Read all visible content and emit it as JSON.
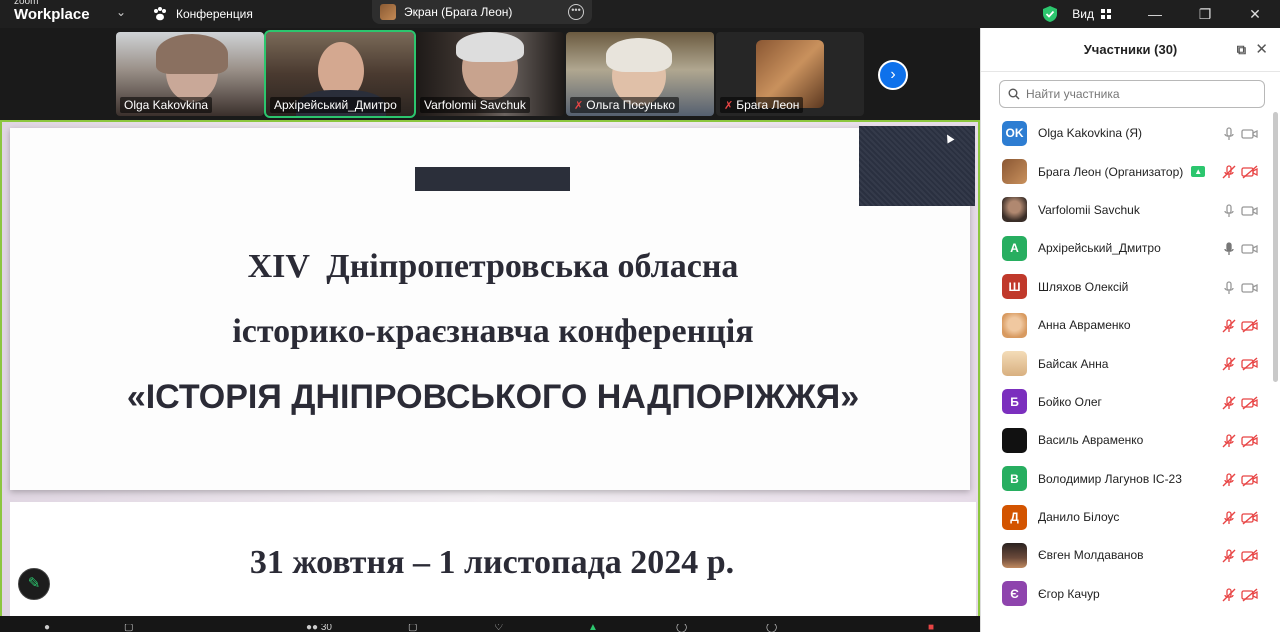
{
  "titlebar": {
    "brand_small": "zoom",
    "brand_main": "Workplace",
    "meeting_label": "Конференция",
    "share_label": "Экран (Брага Леон)",
    "view_label": "Вид"
  },
  "colors": {
    "accent_green": "#2cc66e",
    "accent_blue": "#0e71eb",
    "mute_red": "#e84545",
    "screen_border": "#8cc63f"
  },
  "video_tiles": [
    {
      "name": "Olga Kakovkina",
      "muted": false
    },
    {
      "name": "Архірейський_Дмитро",
      "muted": false,
      "active": true
    },
    {
      "name": "Varfolomii Savchuk",
      "muted": false
    },
    {
      "name": "Ольга Посунько",
      "muted": true
    },
    {
      "name": "Брага Леон",
      "muted": true
    }
  ],
  "slide": {
    "line1": "XIV  Дніпропетровська обласна",
    "line2": "історико-краєзнавча конференція",
    "line3": "«ІСТОРІЯ ДНІПРОВСЬКОГО НАДПОРІЖЖЯ»",
    "date": "31 жовтня – 1 листопада 2024 р."
  },
  "bottombar": {
    "participants_count": "30"
  },
  "panel": {
    "title": "Участники (30)",
    "search_placeholder": "Найти участника",
    "participants": [
      {
        "initials": "OK",
        "name": "Olga Kakovkina (Я)",
        "color": "#2d7dd2",
        "mic": "on",
        "cam": "on"
      },
      {
        "initials": "",
        "name": "Брага Леон (Организатор)",
        "color": "#a0673a",
        "mic": "off",
        "cam": "off",
        "sharing": true
      },
      {
        "initials": "",
        "name": "Varfolomii Savchuk",
        "color": "#5a4a3f",
        "mic": "on",
        "cam": "on"
      },
      {
        "initials": "А",
        "name": "Архірейський_Дмитро",
        "color": "#27ae60",
        "mic": "active",
        "cam": "on"
      },
      {
        "initials": "Ш",
        "name": "Шляхов Олексій",
        "color": "#c0392b",
        "mic": "on",
        "cam": "on"
      },
      {
        "initials": "",
        "name": "Анна Авраменко",
        "color": "#e0a070",
        "mic": "off",
        "cam": "off"
      },
      {
        "initials": "",
        "name": "Байсак Анна",
        "color": "#e8c9a0",
        "mic": "off",
        "cam": "off"
      },
      {
        "initials": "Б",
        "name": "Бойко Олег",
        "color": "#7b2fbe",
        "mic": "off",
        "cam": "off"
      },
      {
        "initials": "",
        "name": "Василь Авраменко",
        "color": "#111111",
        "mic": "off",
        "cam": "off"
      },
      {
        "initials": "В",
        "name": "Володимир Лагунов ІС-23",
        "color": "#27ae60",
        "mic": "off",
        "cam": "off"
      },
      {
        "initials": "Д",
        "name": "Данило Білоус",
        "color": "#d35400",
        "mic": "off",
        "cam": "off"
      },
      {
        "initials": "",
        "name": "Євген Молдаванов",
        "color": "#6b4a3a",
        "mic": "off",
        "cam": "off"
      },
      {
        "initials": "Є",
        "name": "Єгор Качур",
        "color": "#8e44ad",
        "mic": "off",
        "cam": "off"
      }
    ]
  }
}
